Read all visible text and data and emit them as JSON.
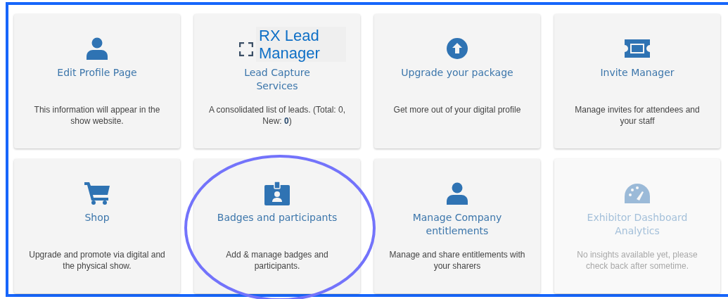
{
  "cards": [
    {
      "title": "Edit Profile Page",
      "description": "This information will appear in the show website.",
      "disabled": false
    },
    {
      "title": "Lead Capture Services",
      "description": "A consolidated list of leads. (Total: 0, New: **0**)",
      "disabled": false,
      "overlay": {
        "title": "RX Lead Manager"
      }
    },
    {
      "title": "Upgrade your package",
      "description": "Get more out of your digital profile",
      "disabled": false
    },
    {
      "title": "Invite Manager",
      "description": "Manage invites for attendees and your staff",
      "disabled": false
    },
    {
      "title": "Shop",
      "description": "Upgrade and promote via digital and the physical show.",
      "disabled": false
    },
    {
      "title": "Badges and participants",
      "description": "Add & manage badges and participants.",
      "disabled": false
    },
    {
      "title": "Manage Company entitlements",
      "description": "Manage and share entitlements with your sharers",
      "disabled": false
    },
    {
      "title": "Exhibitor Dashboard Analytics",
      "description": "No insights available yet, please check back after sometime.",
      "disabled": true
    }
  ]
}
